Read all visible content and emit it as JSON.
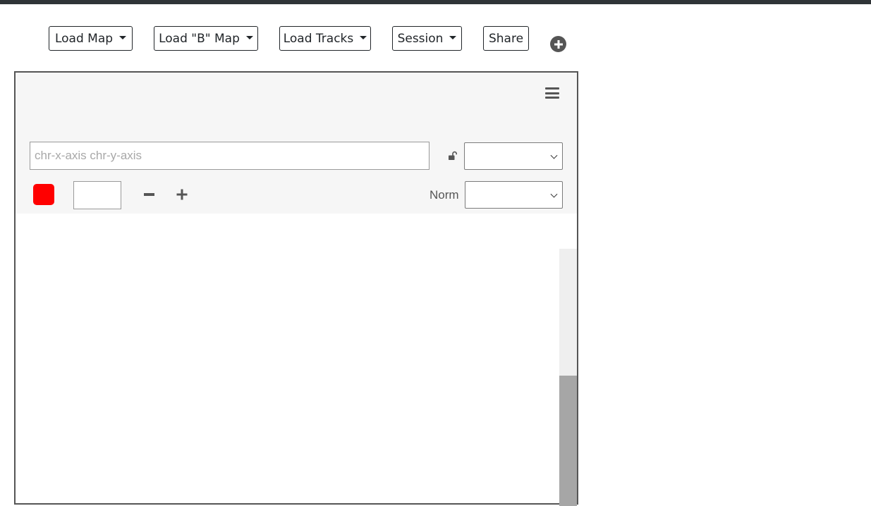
{
  "navbar": {
    "load_map": "Load Map",
    "load_b_map": "Load \"B\" Map",
    "load_tracks": "Load Tracks",
    "session": "Session",
    "share": "Share",
    "add_browser_icon": "plus-circle-icon"
  },
  "panel": {
    "menu_icon": "hamburger-icon",
    "locus_input": {
      "value": "",
      "placeholder": "chr-x-axis chr-y-axis"
    },
    "lock_icon": "unlock-icon",
    "resolution_select": {
      "selected": ""
    },
    "color": {
      "swatch": "#ff0000",
      "value": ""
    },
    "zoom_out_icon": "minus-icon",
    "zoom_in_icon": "plus-icon",
    "normalization": {
      "label": "Norm",
      "selected": ""
    }
  }
}
